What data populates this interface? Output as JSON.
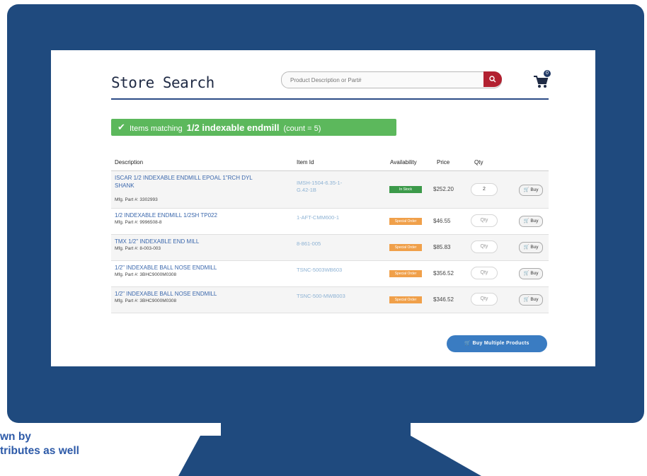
{
  "page": {
    "title": "Store Search"
  },
  "search": {
    "placeholder": "Product Description or Part#"
  },
  "cart": {
    "count": "0"
  },
  "results": {
    "prefix": "Items matching",
    "term": "1/2 indexable endmill",
    "count_text": "(count = 5)"
  },
  "table": {
    "headers": {
      "description": "Description",
      "item_id": "Item Id",
      "availability": "Availability",
      "price": "Price",
      "qty": "Qty"
    },
    "rows": [
      {
        "description": "ISCAR 1/2 INDEXABLE ENDMILL EPOAL 1\"RCH DYL SHANK",
        "mfg": "Mfg. Part #: 3302993",
        "item_id": "IMSH-1504-6.35-1-G.42-1B",
        "availability": "In Stock",
        "availability_status": "in-stock",
        "price": "$252.20",
        "qty": "2",
        "buy": "Buy"
      },
      {
        "description": "1/2 INDEXABLE ENDMILL 1/2SH TP022",
        "mfg": "Mfg. Part #: 9996508-8",
        "item_id": "1-AFT-CMM600-1",
        "availability": "Special Order",
        "availability_status": "special",
        "price": "$46.55",
        "qty": "Qty",
        "buy": "Buy"
      },
      {
        "description": "TMX 1/2\" INDEXABLE END MILL",
        "mfg": "Mfg. Part #: 8-003-003",
        "item_id": "8-861-005",
        "availability": "Special Order",
        "availability_status": "special",
        "price": "$85.83",
        "qty": "Qty",
        "buy": "Buy"
      },
      {
        "description": "1/2\" INDEXABLE BALL NOSE ENDMILL",
        "mfg": "Mfg. Part #: 3BHC9000M0308",
        "item_id": "TSNC-5003WB603",
        "availability": "Special Order",
        "availability_status": "special",
        "price": "$356.52",
        "qty": "Qty",
        "buy": "Buy"
      },
      {
        "description": "1/2\" INDEXABLE BALL NOSE ENDMILL",
        "mfg": "Mfg. Part #: 3BHC9000M0308",
        "item_id": "TSNC-500-MWB003",
        "availability": "Special Order",
        "availability_status": "special",
        "price": "$346.52",
        "qty": "Qty",
        "buy": "Buy"
      }
    ]
  },
  "buy_multiple": {
    "label": "Buy Multiple Products"
  },
  "caption": {
    "line1": "wn by",
    "line2": "tributes as well"
  },
  "colors": {
    "frame": "#1f4a7e",
    "title_rule": "#2c4b87",
    "banner": "#5cb85c",
    "link": "#3a67ac",
    "in_stock": "#3c9a4a",
    "special_order": "#f0a04a",
    "search_button": "#b22030",
    "buy_multiple": "#3a7cc2"
  }
}
